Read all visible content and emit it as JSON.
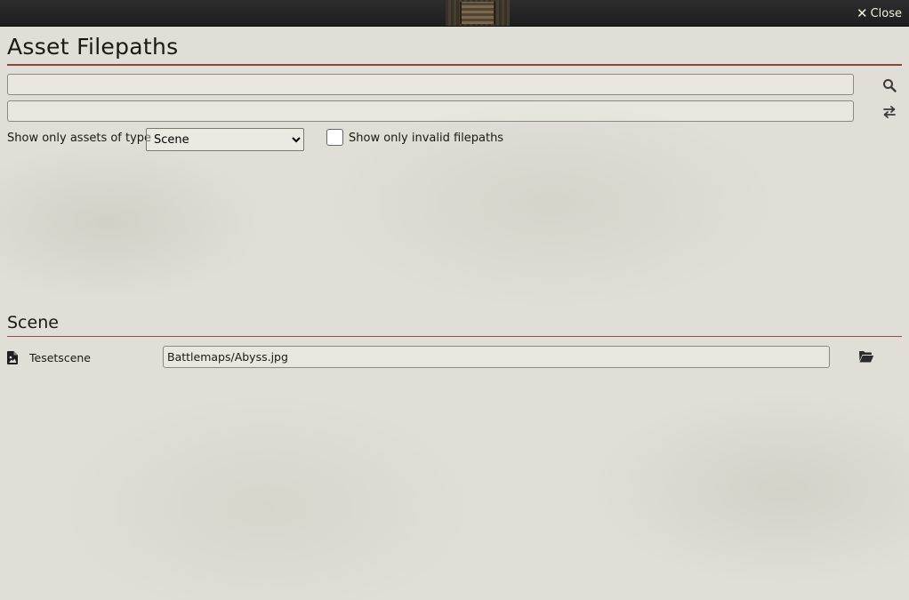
{
  "topbar": {
    "close_label": "Close"
  },
  "page": {
    "title": "Asset Filepaths"
  },
  "search": {
    "find_value": "",
    "replace_value": ""
  },
  "filter": {
    "type_label": "Show only assets of type",
    "type_selected": "Scene",
    "invalid_label": "Show only invalid filepaths",
    "invalid_checked": false
  },
  "sections": [
    {
      "title": "Scene",
      "assets": [
        {
          "name": "Tesetscene",
          "path": "Battlemaps/Abyss.jpg",
          "icon": "file-image-icon"
        }
      ]
    }
  ],
  "colors": {
    "accent": "#782e22",
    "topbar": "#262626",
    "background": "#e0ded7"
  }
}
